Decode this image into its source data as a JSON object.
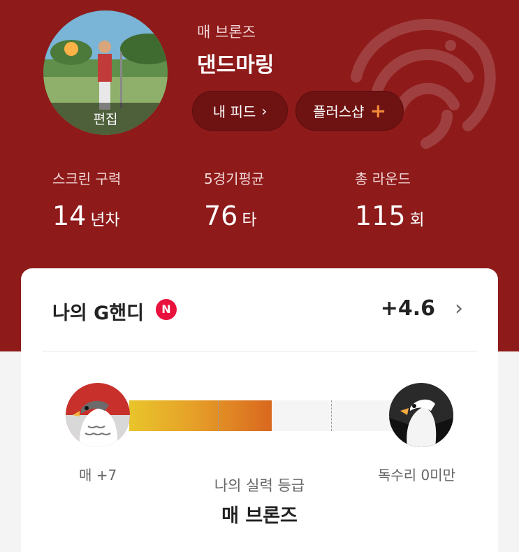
{
  "profile": {
    "edit_label": "편집",
    "grade": "매 브론즈",
    "nickname": "댄드마링",
    "feed_button": "내 피드",
    "shop_button": "플러스샵"
  },
  "stats": [
    {
      "label": "스크린 구력",
      "value": "14",
      "unit": "년차"
    },
    {
      "label": "5경기평균",
      "value": "76",
      "unit": "타"
    },
    {
      "label": "총 라운드",
      "value": "115",
      "unit": "회"
    }
  ],
  "handicap": {
    "title": "나의 G핸디",
    "badge": "N",
    "value": "+4.6"
  },
  "level": {
    "left_label": "매 +7",
    "right_label": "독수리 0미만",
    "progress_fraction": 0.53,
    "caption": "나의 실력 등급",
    "grade": "매 브론즈"
  },
  "colors": {
    "header_bg": "#8e1a1a",
    "badge_red": "#e8123c",
    "plus_orange": "#f08a3a"
  },
  "icons": {
    "shop_plus": "plus-icon",
    "feed_chevron": "chevron-right-icon",
    "handicap_chevron": "chevron-right-icon",
    "left_bird": "hawk-icon",
    "right_bird": "eagle-icon"
  }
}
